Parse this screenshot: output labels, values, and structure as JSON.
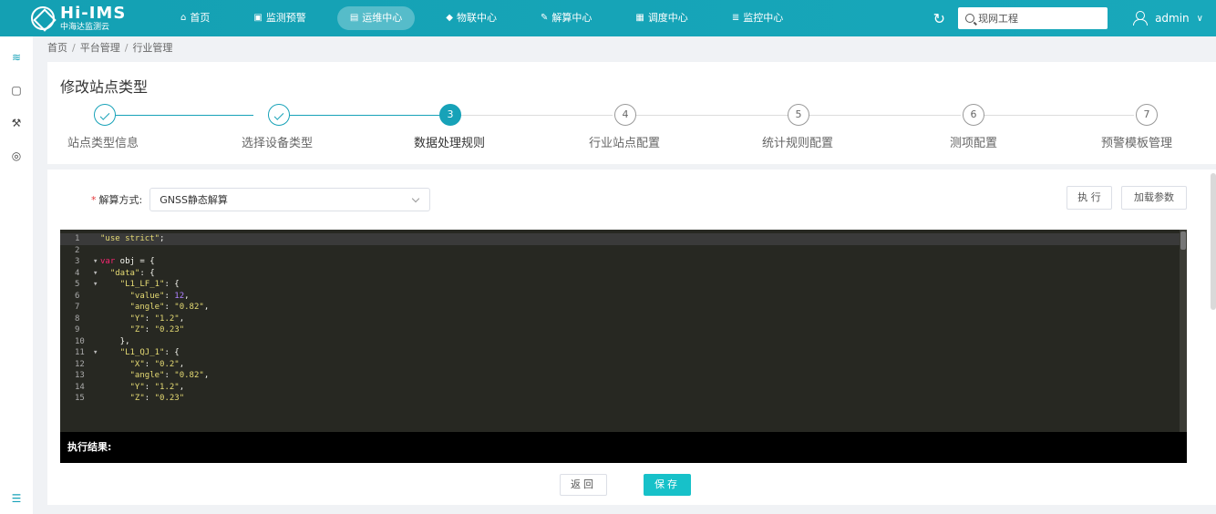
{
  "header": {
    "logo_main": "Hi-IMS",
    "logo_sub": "中海达监测云",
    "nav": [
      {
        "icon": "home-icon",
        "glyph": "⌂",
        "label": "首页",
        "active": false
      },
      {
        "icon": "monitor-warning-icon",
        "glyph": "▣",
        "label": "监测预警",
        "active": false
      },
      {
        "icon": "operation-icon",
        "glyph": "▤",
        "label": "运维中心",
        "active": true
      },
      {
        "icon": "iot-icon",
        "glyph": "◆",
        "label": "物联中心",
        "active": false
      },
      {
        "icon": "solve-icon",
        "glyph": "✎",
        "label": "解算中心",
        "active": false
      },
      {
        "icon": "dispatch-icon",
        "glyph": "▦",
        "label": "调度中心",
        "active": false
      },
      {
        "icon": "control-icon",
        "glyph": "≣",
        "label": "监控中心",
        "active": false
      }
    ],
    "search_value": "现网工程",
    "user": "admin"
  },
  "breadcrumb": [
    "首页",
    "平台管理",
    "行业管理"
  ],
  "page_title": "修改站点类型",
  "steps": [
    {
      "num": "1",
      "label": "站点类型信息",
      "state": "done"
    },
    {
      "num": "2",
      "label": "选择设备类型",
      "state": "done"
    },
    {
      "num": "3",
      "label": "数据处理规则",
      "state": "active"
    },
    {
      "num": "4",
      "label": "行业站点配置",
      "state": "pending"
    },
    {
      "num": "5",
      "label": "统计规则配置",
      "state": "pending"
    },
    {
      "num": "6",
      "label": "测项配置",
      "state": "pending"
    },
    {
      "num": "7",
      "label": "预警模板管理",
      "state": "pending"
    }
  ],
  "form": {
    "required_mark": "*",
    "solve_label": "解算方式:",
    "solve_value": "GNSS静态解算"
  },
  "buttons": {
    "execute": "执 行",
    "load_params": "加载参数",
    "back": "返回",
    "save": "保存"
  },
  "code_lines": [
    {
      "n": "1",
      "fold": "",
      "text": "\"use strict\";"
    },
    {
      "n": "2",
      "fold": "",
      "text": ""
    },
    {
      "n": "3",
      "fold": "▾",
      "text": "var obj = {"
    },
    {
      "n": "4",
      "fold": "▾",
      "text": "  \"data\": {"
    },
    {
      "n": "5",
      "fold": "▾",
      "text": "    \"L1_LF_1\": {"
    },
    {
      "n": "6",
      "fold": "",
      "text": "      \"value\": 12,"
    },
    {
      "n": "7",
      "fold": "",
      "text": "      \"angle\": \"0.82\","
    },
    {
      "n": "8",
      "fold": "",
      "text": "      \"Y\": \"1.2\","
    },
    {
      "n": "9",
      "fold": "",
      "text": "      \"Z\": \"0.23\""
    },
    {
      "n": "10",
      "fold": "",
      "text": "    },"
    },
    {
      "n": "11",
      "fold": "▾",
      "text": "    \"L1_QJ_1\": {"
    },
    {
      "n": "12",
      "fold": "",
      "text": "      \"X\": \"0.2\","
    },
    {
      "n": "13",
      "fold": "",
      "text": "      \"angle\": \"0.82\","
    },
    {
      "n": "14",
      "fold": "",
      "text": "      \"Y\": \"1.2\","
    },
    {
      "n": "15",
      "fold": "",
      "text": "      \"Z\": \"0.23\""
    }
  ],
  "result_label": "执行结果:",
  "colors": {
    "accent": "#17a2b8",
    "editor_bg": "#272822",
    "string": "#e6db74",
    "number": "#ae81ff",
    "keyword": "#f92672"
  }
}
